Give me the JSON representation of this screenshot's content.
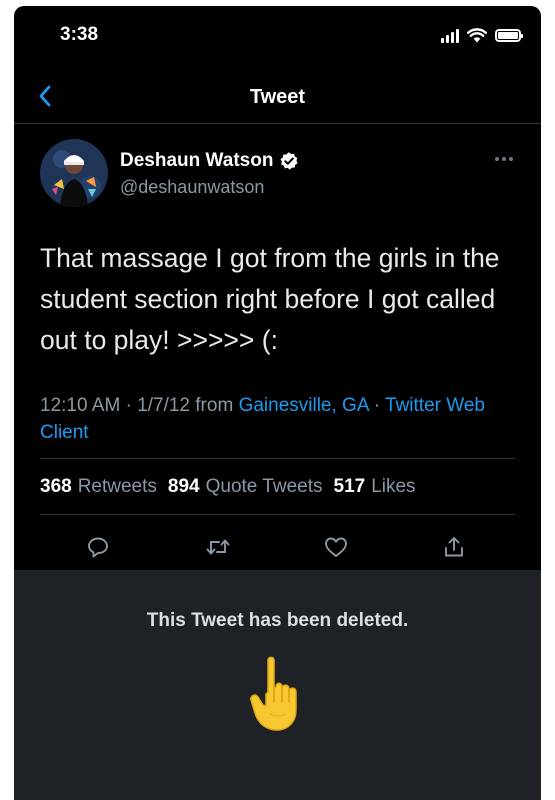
{
  "status_bar": {
    "time": "3:38"
  },
  "nav": {
    "title": "Tweet"
  },
  "tweet": {
    "author_name": "Deshaun Watson",
    "handle": "@deshaunwatson",
    "text": "That massage I got from the girls in the student section right before I got called out to play! >>>>> (:",
    "time": "12:10 AM",
    "date": "1/7/12",
    "from_label": "from",
    "location": "Gainesville, GA",
    "separator": "·",
    "client": "Twitter Web Client"
  },
  "stats": [
    {
      "count": "368",
      "label": "Retweets"
    },
    {
      "count": "894",
      "label": "Quote Tweets"
    },
    {
      "count": "517",
      "label": "Likes"
    }
  ],
  "notice": {
    "text": "This Tweet has been deleted."
  },
  "icons": [
    "chevron-left-icon",
    "verified-badge-icon",
    "more-icon",
    "reply-icon",
    "retweet-icon",
    "like-icon",
    "share-icon",
    "pointing-hand-emoji"
  ],
  "colors": {
    "accent": "#1d9bf0",
    "background": "#000000",
    "deleted_panel": "#1e2227",
    "muted_text": "#8b98a5"
  }
}
